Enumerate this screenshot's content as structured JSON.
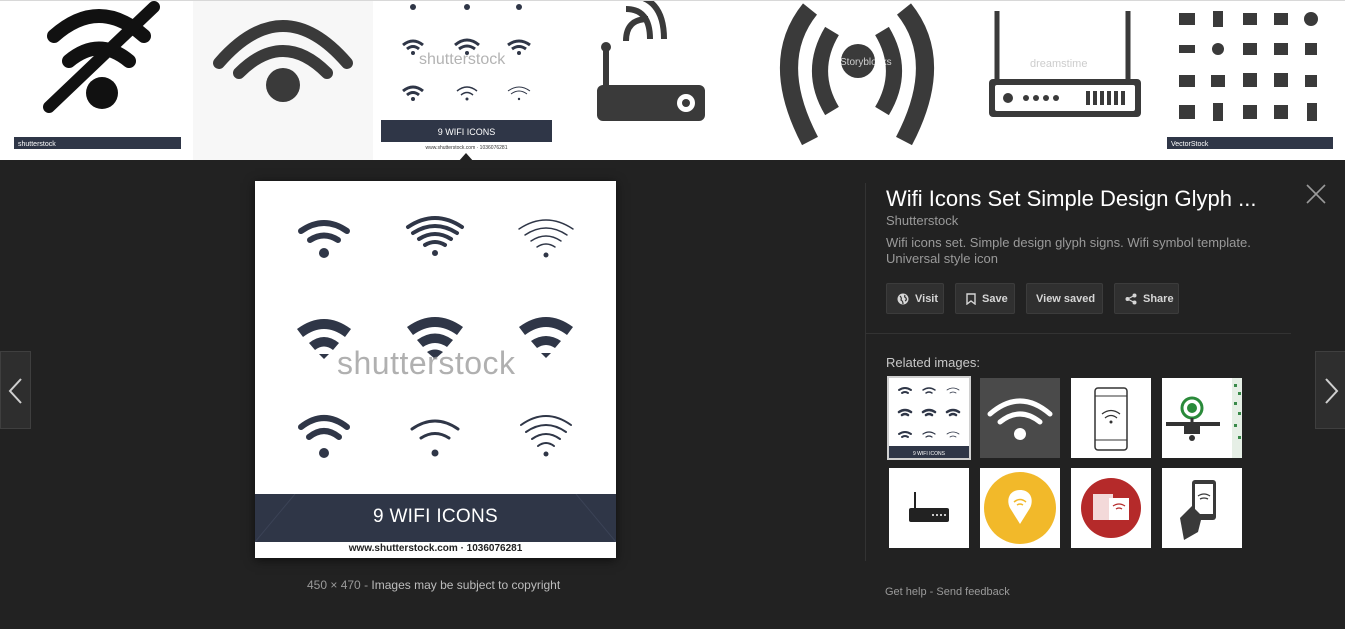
{
  "thumbnails": [
    {
      "name": "wifi-off-thumb",
      "brand": "shutterstock"
    },
    {
      "name": "wifi-signal-thumb"
    },
    {
      "name": "wifi-icons-set-thumb",
      "watermark": "shutterstock",
      "banner": "9 WIFI ICONS",
      "footer": "www.shutterstock.com · 1036076281"
    },
    {
      "name": "router-thumb"
    },
    {
      "name": "broadcast-thumb",
      "watermark": "Storyblocks"
    },
    {
      "name": "router-box-thumb",
      "watermark": "dreamstime"
    },
    {
      "name": "device-icons-thumb",
      "brand": "VectorStock"
    }
  ],
  "viewer": {
    "image": {
      "watermark": "shutterstock",
      "banner": "9 WIFI ICONS",
      "footer": "www.shutterstock.com · 1036076281"
    },
    "dimensions": "450 × 470",
    "separator": "-",
    "copyright": "Images may be subject to copyright"
  },
  "info": {
    "title": "Wifi Icons Set Simple Design Glyph ...",
    "source": "Shutterstock",
    "description": "Wifi icons set. Simple design glyph signs. Wifi symbol template. Universal style icon",
    "buttons": {
      "visit": "Visit",
      "save": "Save",
      "view_saved": "View saved",
      "share": "Share"
    },
    "related_label": "Related images:",
    "related": [
      {
        "name": "related-wifi-icons-set",
        "selected": true,
        "banner": "9 WIFI ICONS"
      },
      {
        "name": "related-wifi-dark"
      },
      {
        "name": "related-tablet-wifi"
      },
      {
        "name": "related-drone-signal"
      },
      {
        "name": "related-router"
      },
      {
        "name": "related-location-wifi"
      },
      {
        "name": "related-wifi-devices"
      },
      {
        "name": "related-hand-phone"
      }
    ]
  },
  "footer": {
    "help": "Get help",
    "separator": "-",
    "feedback": "Send feedback"
  },
  "colors": {
    "background": "#222222",
    "banner": "#2f3647",
    "icon": "#2f3647",
    "button_bg": "#303030"
  }
}
